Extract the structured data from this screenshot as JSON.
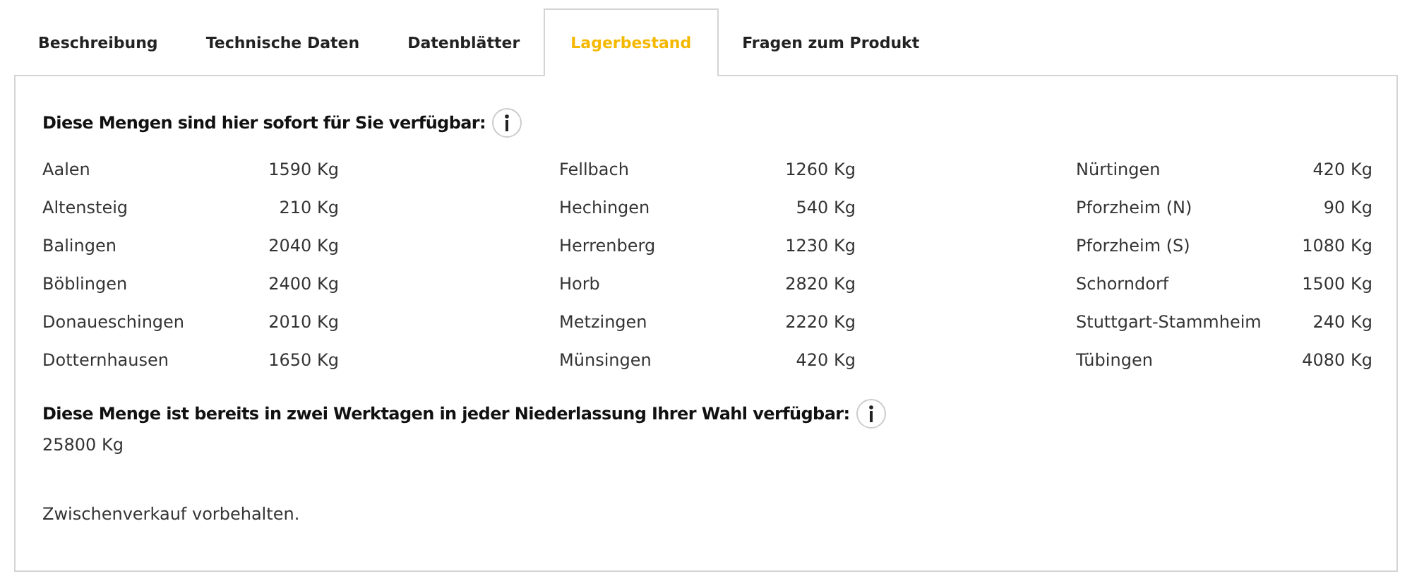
{
  "tabs": [
    {
      "label": "Beschreibung",
      "selected": false
    },
    {
      "label": "Technische Daten",
      "selected": false
    },
    {
      "label": "Datenblätter",
      "selected": false
    },
    {
      "label": "Lagerbestand",
      "selected": true
    },
    {
      "label": "Fragen zum Produkt",
      "selected": false
    }
  ],
  "immediate": {
    "heading": "Diese Mengen sind hier sofort für Sie verfügbar:",
    "columns": [
      [
        {
          "location": "Aalen",
          "quantity": "1590 Kg"
        },
        {
          "location": "Altensteig",
          "quantity": "210 Kg"
        },
        {
          "location": "Balingen",
          "quantity": "2040 Kg"
        },
        {
          "location": "Böblingen",
          "quantity": "2400 Kg"
        },
        {
          "location": "Donaueschingen",
          "quantity": "2010 Kg"
        },
        {
          "location": "Dotternhausen",
          "quantity": "1650 Kg"
        }
      ],
      [
        {
          "location": "Fellbach",
          "quantity": "1260 Kg"
        },
        {
          "location": "Hechingen",
          "quantity": "540 Kg"
        },
        {
          "location": "Herrenberg",
          "quantity": "1230 Kg"
        },
        {
          "location": "Horb",
          "quantity": "2820 Kg"
        },
        {
          "location": "Metzingen",
          "quantity": "2220 Kg"
        },
        {
          "location": "Münsingen",
          "quantity": "420 Kg"
        }
      ],
      [
        {
          "location": "Nürtingen",
          "quantity": "420 Kg"
        },
        {
          "location": "Pforzheim (N)",
          "quantity": "90 Kg"
        },
        {
          "location": "Pforzheim (S)",
          "quantity": "1080 Kg"
        },
        {
          "location": "Schorndorf",
          "quantity": "1500 Kg"
        },
        {
          "location": "Stuttgart-Stammheim",
          "quantity": "240 Kg"
        },
        {
          "location": "Tübingen",
          "quantity": "4080 Kg"
        }
      ]
    ]
  },
  "two_days": {
    "heading": "Diese Menge ist bereits in zwei Werktagen in jeder Niederlassung Ihrer Wahl verfügbar:",
    "quantity": "25800 Kg"
  },
  "note": "Zwischenverkauf vorbehalten."
}
